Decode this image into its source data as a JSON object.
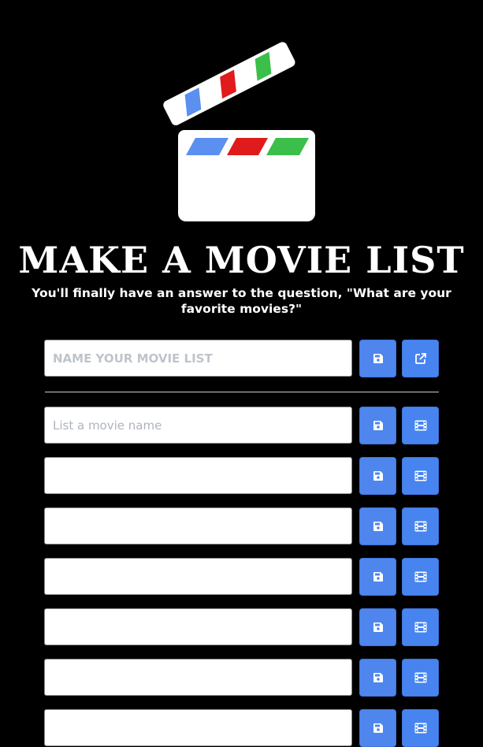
{
  "header": {
    "logo_icon": "clapperboard-icon",
    "title": "MAKE A MOVIE LIST",
    "subtitle": "You'll finally have an answer to the question, \"What are your favorite movies?\""
  },
  "list_name": {
    "placeholder": "NAME YOUR MOVIE LIST",
    "value": "",
    "save_icon": "save-icon",
    "share_icon": "external-link-icon"
  },
  "movies": [
    {
      "placeholder": "List a movie name",
      "value": ""
    },
    {
      "placeholder": "",
      "value": ""
    },
    {
      "placeholder": "",
      "value": ""
    },
    {
      "placeholder": "",
      "value": ""
    },
    {
      "placeholder": "",
      "value": ""
    },
    {
      "placeholder": "",
      "value": ""
    },
    {
      "placeholder": "",
      "value": ""
    }
  ],
  "movie_row_icons": {
    "save": "save-icon",
    "film": "film-icon"
  },
  "colors": {
    "background": "#000000",
    "button": "#4e86ee",
    "stripe_blue": "#5b8ff0",
    "stripe_red": "#e01b1b",
    "stripe_green": "#3bbf4a"
  }
}
